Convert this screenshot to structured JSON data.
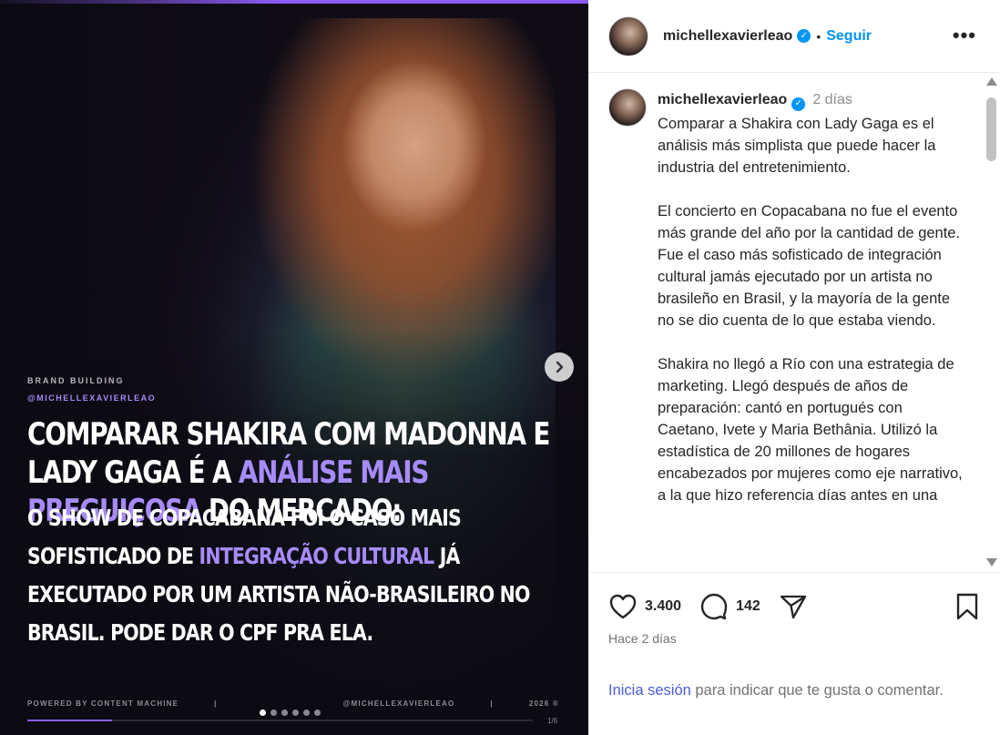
{
  "post_media": {
    "kicker": "BRAND BUILDING",
    "kicker_handle": "@MICHELLEXAVIERLEAO",
    "headline": {
      "part1": "COMPARAR SHAKIRA COM MADONNA E LADY GAGA É A ",
      "highlight": "ANÁLISE MAIS PREGUIÇOSA",
      "part2": " DO MERCADO:"
    },
    "body": {
      "part1": " O SHOW DE COPACABANA FOI O CASO MAIS SOFISTICADO DE ",
      "highlight": "INTEGRAÇÃO CULTURAL",
      "part2": " JÁ EXECUTADO POR UM ARTISTA NÃO-BRASILEIRO NO BRASIL. PODE DAR O CPF PRA ELA."
    },
    "footer": {
      "left": "POWERED BY CONTENT MACHINE",
      "divider": "|",
      "center": "@MICHELLEXAVIERLEAO",
      "right": "2026 ®"
    },
    "page_counter": "1/6",
    "progress_fraction": 0.1667,
    "carousel": {
      "total_dots": 6,
      "active_index": 0
    },
    "accent_color": "#a78bfa",
    "next_icon": "chevron-right-icon"
  },
  "header": {
    "username": "michellexavierleao",
    "separator": "•",
    "follow_label": "Seguir",
    "more_label": "•••"
  },
  "caption": {
    "username": "michellexavierleao",
    "time": "2 días",
    "paragraphs": [
      "Comparar a Shakira con Lady Gaga es el análisis más simplista que puede hacer la industria del entretenimiento.",
      "El concierto en Copacabana no fue el evento más grande del año por la cantidad de gente. Fue el caso más sofisticado de integración cultural jamás ejecutado por un artista no brasileño en Brasil, y la mayoría de la gente no se dio cuenta de lo que estaba viendo.",
      "Shakira no llegó a Río con una estrategia de marketing. Llegó después de años de preparación: cantó en portugués con Caetano, Ivete y Maria Bethânia. Utilizó la estadística de 20 millones de hogares encabezados por mujeres como eje narrativo, a la que hizo referencia días antes en una"
    ]
  },
  "actions": {
    "likes": "3.400",
    "comments": "142",
    "time_ago": "Hace 2 días"
  },
  "login_cta": {
    "link": "Inicia sesión",
    "rest": " para indicar que te gusta o comentar."
  }
}
